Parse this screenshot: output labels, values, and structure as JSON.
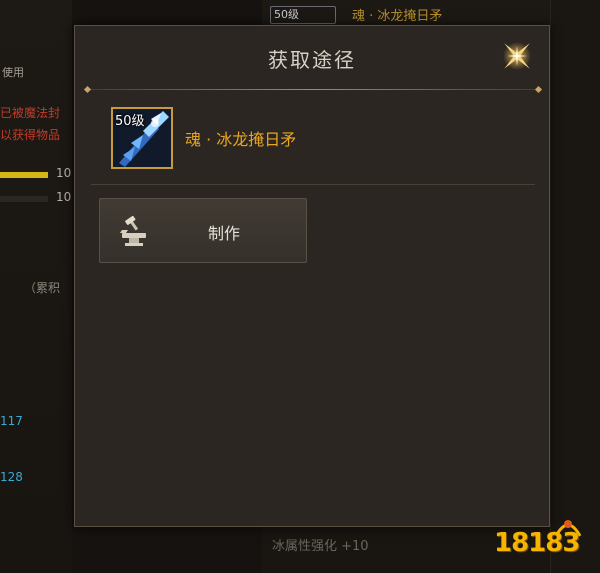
{
  "background": {
    "left_texts": [
      "使用",
      "已被魔法封",
      "以获得物品",
      "10",
      "10",
      "（累积",
      "117",
      "128"
    ],
    "top_item_level": "50级",
    "top_item_name": "魂 · 冰龙掩日矛",
    "bottom_stat": "冰属性强化 +10"
  },
  "modal": {
    "title": "获取途径",
    "close_icon": "close-star-icon",
    "item": {
      "level": "50级",
      "name": "魂 · 冰龙掩日矛",
      "icon": "ice-spear-icon"
    },
    "sources": [
      {
        "label": "制作",
        "icon": "anvil-hammer-icon"
      }
    ]
  },
  "watermark": {
    "text": "18183",
    "icon": "watermark-logo"
  },
  "colors": {
    "item_name": "#e8a520",
    "frame_gold": "#c79a3a",
    "modal_bg": "#2b2622"
  }
}
